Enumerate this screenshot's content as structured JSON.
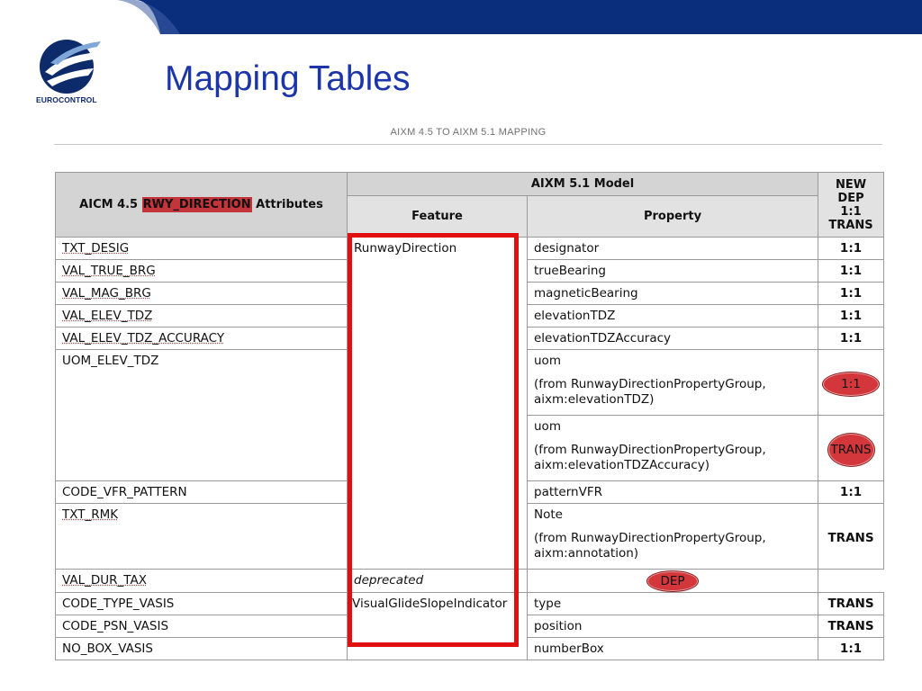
{
  "brand": {
    "logo_text": "EUROCONTROL",
    "bar_color": "#0a2d7c",
    "title_color": "#1c35a8"
  },
  "slide": {
    "title": "Mapping Tables"
  },
  "document": {
    "subtitle": "AIXM 4.5 TO AIXM 5.1 MAPPING"
  },
  "table": {
    "head": {
      "aicm_prefix": "AICM 4.5",
      "aicm_entity": "RWY_DIRECTION",
      "aicm_suffix": "Attributes",
      "aixm_model": "AIXM 5.1 Model",
      "feature": "Feature",
      "property": "Property",
      "mapping_lines": [
        "NEW",
        "DEP",
        "1:1",
        "TRANS"
      ]
    },
    "rows": [
      {
        "attribute": "TXT_DESIG",
        "feature": "RunwayDirection",
        "property": "designator",
        "mapping": "1:1"
      },
      {
        "attribute": "VAL_TRUE_BRG",
        "property": "trueBearing",
        "mapping": "1:1"
      },
      {
        "attribute": "VAL_MAG_BRG",
        "property": "magneticBearing",
        "mapping": "1:1"
      },
      {
        "attribute": "VAL_ELEV_TDZ",
        "property": "elevationTDZ",
        "mapping": "1:1"
      },
      {
        "attribute": "VAL_ELEV_TDZ_ACCURACY",
        "property": "elevationTDZAccuracy",
        "mapping": "1:1"
      },
      {
        "attribute": "UOM_ELEV_TDZ",
        "sub": [
          {
            "property": "uom",
            "note1": "(from RunwayDirectionPropertyGroup,",
            "note2": "aixm:elevationTDZ)",
            "mapping": "1:1"
          },
          {
            "property": "uom",
            "note1": "(from RunwayDirectionPropertyGroup,",
            "note2": "aixm:elevationTDZAccuracy)",
            "mapping": "TRANS"
          }
        ]
      },
      {
        "attribute": "CODE_VFR_PATTERN",
        "property": "patternVFR",
        "mapping": "1:1"
      },
      {
        "attribute": "TXT_RMK",
        "property": "Note",
        "note1": "(from RunwayDirectionPropertyGroup,",
        "note2": "aixm:annotation)",
        "mapping": "TRANS"
      },
      {
        "attribute": "VAL_DUR_TAX",
        "property": "deprecated",
        "mapping": "DEP"
      },
      {
        "attribute": "CODE_TYPE_VASIS",
        "feature": "VisualGlideSlopeIndicator",
        "property": "type",
        "mapping": "TRANS"
      },
      {
        "attribute": "CODE_PSN_VASIS",
        "property": "position",
        "mapping": "TRANS"
      },
      {
        "attribute": "NO_BOX_VASIS",
        "property": "numberBox",
        "mapping": "1:1"
      }
    ]
  }
}
